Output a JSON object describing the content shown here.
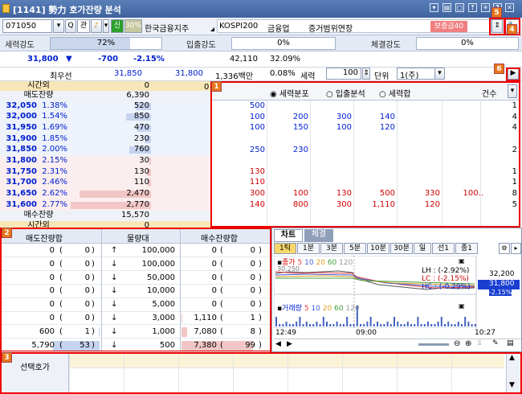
{
  "title": "[1141] 勢力 호가잔량 분석",
  "toolbar": {
    "code": "071050",
    "q_btn": "Q",
    "gwan": "관",
    "sin": "신",
    "pct30": "30%",
    "stock_name": "한국금융지주",
    "index_name": "KOSPI200",
    "sector": "금융업",
    "note": "증거범위연장",
    "margin": "보증금40"
  },
  "power": {
    "label1": "세력강도",
    "val1": "72%",
    "label2": "입출강도",
    "val2": "0%",
    "label3": "체결강도",
    "val3": "0%"
  },
  "price_row": {
    "price": "31,800",
    "arrow": "▼",
    "change": "-700",
    "change_pct": "-2.15%",
    "volume": "42,110",
    "vol_pct": "32.09%"
  },
  "best_row": {
    "label": "최우선",
    "bid": "31,850",
    "ask": "31,800",
    "amount": "1,336백만",
    "pct": "0.08%",
    "seryeok_label": "세력",
    "seryeok_val": "100",
    "unit_label": "단위",
    "unit_val": "1(주)"
  },
  "left_table": {
    "after_hours": "시간외",
    "after_val_top": "0",
    "ask_label": "매도잔량",
    "ask_total": "6,390",
    "rows": [
      {
        "p": "32,050",
        "r": "1.38%",
        "q": "520",
        "side": "ask"
      },
      {
        "p": "32,000",
        "r": "1.54%",
        "q": "850",
        "side": "ask"
      },
      {
        "p": "31,950",
        "r": "1.69%",
        "q": "470",
        "side": "ask"
      },
      {
        "p": "31,900",
        "r": "1.85%",
        "q": "230",
        "side": "ask"
      },
      {
        "p": "31,850",
        "r": "2.00%",
        "q": "760",
        "side": "ask"
      },
      {
        "p": "31,800",
        "r": "2.15%",
        "q": "30",
        "side": "bid"
      },
      {
        "p": "31,750",
        "r": "2.31%",
        "q": "130",
        "side": "bid"
      },
      {
        "p": "31,700",
        "r": "2.46%",
        "q": "110",
        "side": "bid"
      },
      {
        "p": "31,650",
        "r": "2.62%",
        "q": "2,470",
        "side": "bid"
      },
      {
        "p": "31,600",
        "r": "2.77%",
        "q": "2,770",
        "side": "bid"
      }
    ],
    "bid_label": "매수잔량",
    "bid_total": "15,570",
    "after_val_bottom": "0"
  },
  "right_table": {
    "top_zero": "0",
    "radio1": "세력분포",
    "radio2": "입출분석",
    "radio3": "세력합",
    "count_label": "건수",
    "rows": [
      {
        "v": [
          "500",
          "",
          "",
          "",
          "",
          ""
        ],
        "n": "1",
        "side": "ask"
      },
      {
        "v": [
          "100",
          "200",
          "300",
          "140",
          "",
          ""
        ],
        "n": "4",
        "side": "ask"
      },
      {
        "v": [
          "100",
          "150",
          "100",
          "120",
          "",
          ""
        ],
        "n": "4",
        "side": "ask"
      },
      {
        "v": [
          "",
          "",
          "",
          "",
          "",
          ""
        ],
        "n": "",
        "side": "ask"
      },
      {
        "v": [
          "250",
          "230",
          "",
          "",
          "",
          ""
        ],
        "n": "2",
        "side": "ask"
      },
      {
        "v": [
          "",
          "",
          "",
          "",
          "",
          ""
        ],
        "n": "",
        "side": "bid"
      },
      {
        "v": [
          "130",
          "",
          "",
          "",
          "",
          ""
        ],
        "n": "1",
        "side": "bid"
      },
      {
        "v": [
          "110",
          "",
          "",
          "",
          "",
          ""
        ],
        "n": "1",
        "side": "bid"
      },
      {
        "v": [
          "300",
          "100",
          "130",
          "500",
          "330",
          "100.."
        ],
        "n": "8",
        "side": "bid"
      },
      {
        "v": [
          "140",
          "800",
          "300",
          "1,110",
          "120",
          ""
        ],
        "n": "5",
        "side": "bid"
      }
    ]
  },
  "bottom_left": {
    "h1": "매도잔량합",
    "h2": "물량대",
    "h3": "매수잔량합",
    "rows": [
      {
        "a": "0",
        "ap": "0",
        "arr": "↑",
        "m": "100,000",
        "b": "0",
        "bp": "0"
      },
      {
        "a": "0",
        "ap": "0",
        "arr": "↓",
        "m": "100,000",
        "b": "0",
        "bp": "0"
      },
      {
        "a": "0",
        "ap": "0",
        "arr": "↓",
        "m": "50,000",
        "b": "0",
        "bp": "0"
      },
      {
        "a": "0",
        "ap": "0",
        "arr": "↓",
        "m": "10,000",
        "b": "0",
        "bp": "0"
      },
      {
        "a": "0",
        "ap": "0",
        "arr": "↓",
        "m": "5,000",
        "b": "0",
        "bp": "0"
      },
      {
        "a": "0",
        "ap": "0",
        "arr": "↓",
        "m": "3,000",
        "b": "1,110",
        "bp": "1"
      },
      {
        "a": "600",
        "ap": "1",
        "arr": "↓",
        "m": "1,000",
        "b": "7,080",
        "bp": "8"
      },
      {
        "a": "5,790",
        "ap": "53",
        "arr": "↓",
        "m": "500",
        "b": "7,380",
        "bp": "99"
      }
    ]
  },
  "chart": {
    "tab1": "차트",
    "tab2": "체결",
    "periods": [
      "1틱",
      "1분",
      "3분",
      "5분",
      "10분",
      "30분",
      "일",
      "선1",
      "종1"
    ],
    "legend_price": "종가",
    "ma": [
      "5",
      "10",
      "20",
      "60",
      "120"
    ],
    "lh": "LH : (-2.92%)",
    "lc": "LC : (-2.15%)",
    "hc": "HC : (-0.29%)",
    "y_top": "32,200",
    "y_cur": "31,800",
    "y_cur_pct": "-2.15%",
    "start_label": "30,250",
    "vol_label": "거래량",
    "times": [
      "12:49",
      "09:00",
      "10:27"
    ]
  },
  "bottom": {
    "label": "선택호가"
  },
  "badges": [
    "1",
    "2",
    "3",
    "4",
    "5",
    "6"
  ]
}
